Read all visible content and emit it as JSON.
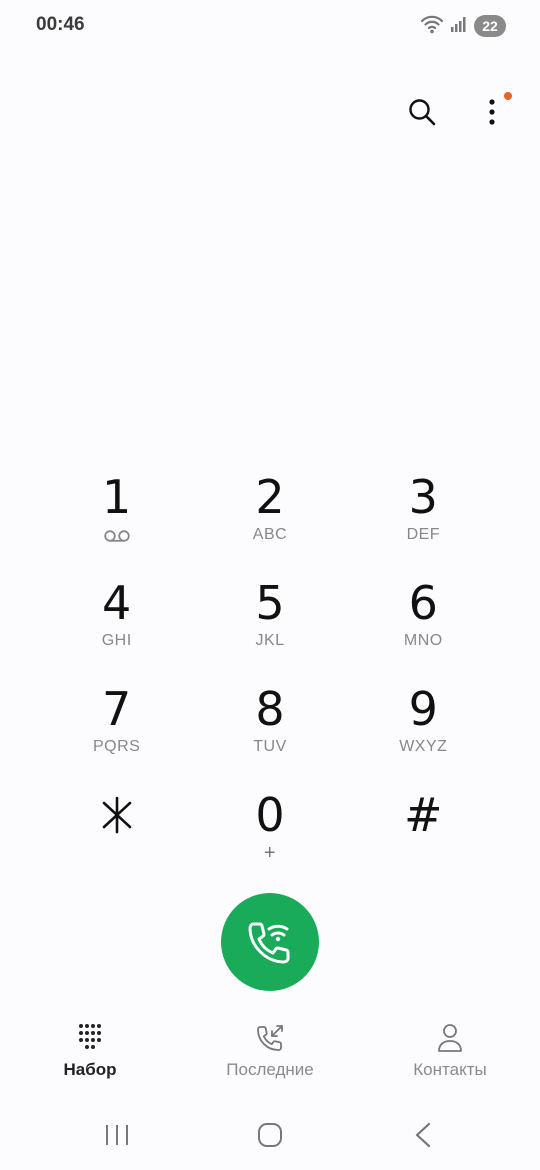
{
  "status": {
    "time": "00:46",
    "battery": "22"
  },
  "dialpad": {
    "keys": [
      {
        "digit": "1",
        "letters": ""
      },
      {
        "digit": "2",
        "letters": "ABC"
      },
      {
        "digit": "3",
        "letters": "DEF"
      },
      {
        "digit": "4",
        "letters": "GHI"
      },
      {
        "digit": "5",
        "letters": "JKL"
      },
      {
        "digit": "6",
        "letters": "MNO"
      },
      {
        "digit": "7",
        "letters": "PQRS"
      },
      {
        "digit": "8",
        "letters": "TUV"
      },
      {
        "digit": "9",
        "letters": "WXYZ"
      },
      {
        "digit": "*",
        "letters": ""
      },
      {
        "digit": "0",
        "letters": "+"
      },
      {
        "digit": "#",
        "letters": ""
      }
    ]
  },
  "tabs": {
    "dialer": "Набор",
    "recents": "Последние",
    "contacts": "Контакты"
  },
  "colors": {
    "call_green": "#1aab5a",
    "notification_dot": "#e8612a"
  },
  "icons": {
    "search": "search-icon",
    "more": "more-vert-icon",
    "voicemail": "voicemail-icon",
    "call": "phone-wifi-call-icon"
  }
}
